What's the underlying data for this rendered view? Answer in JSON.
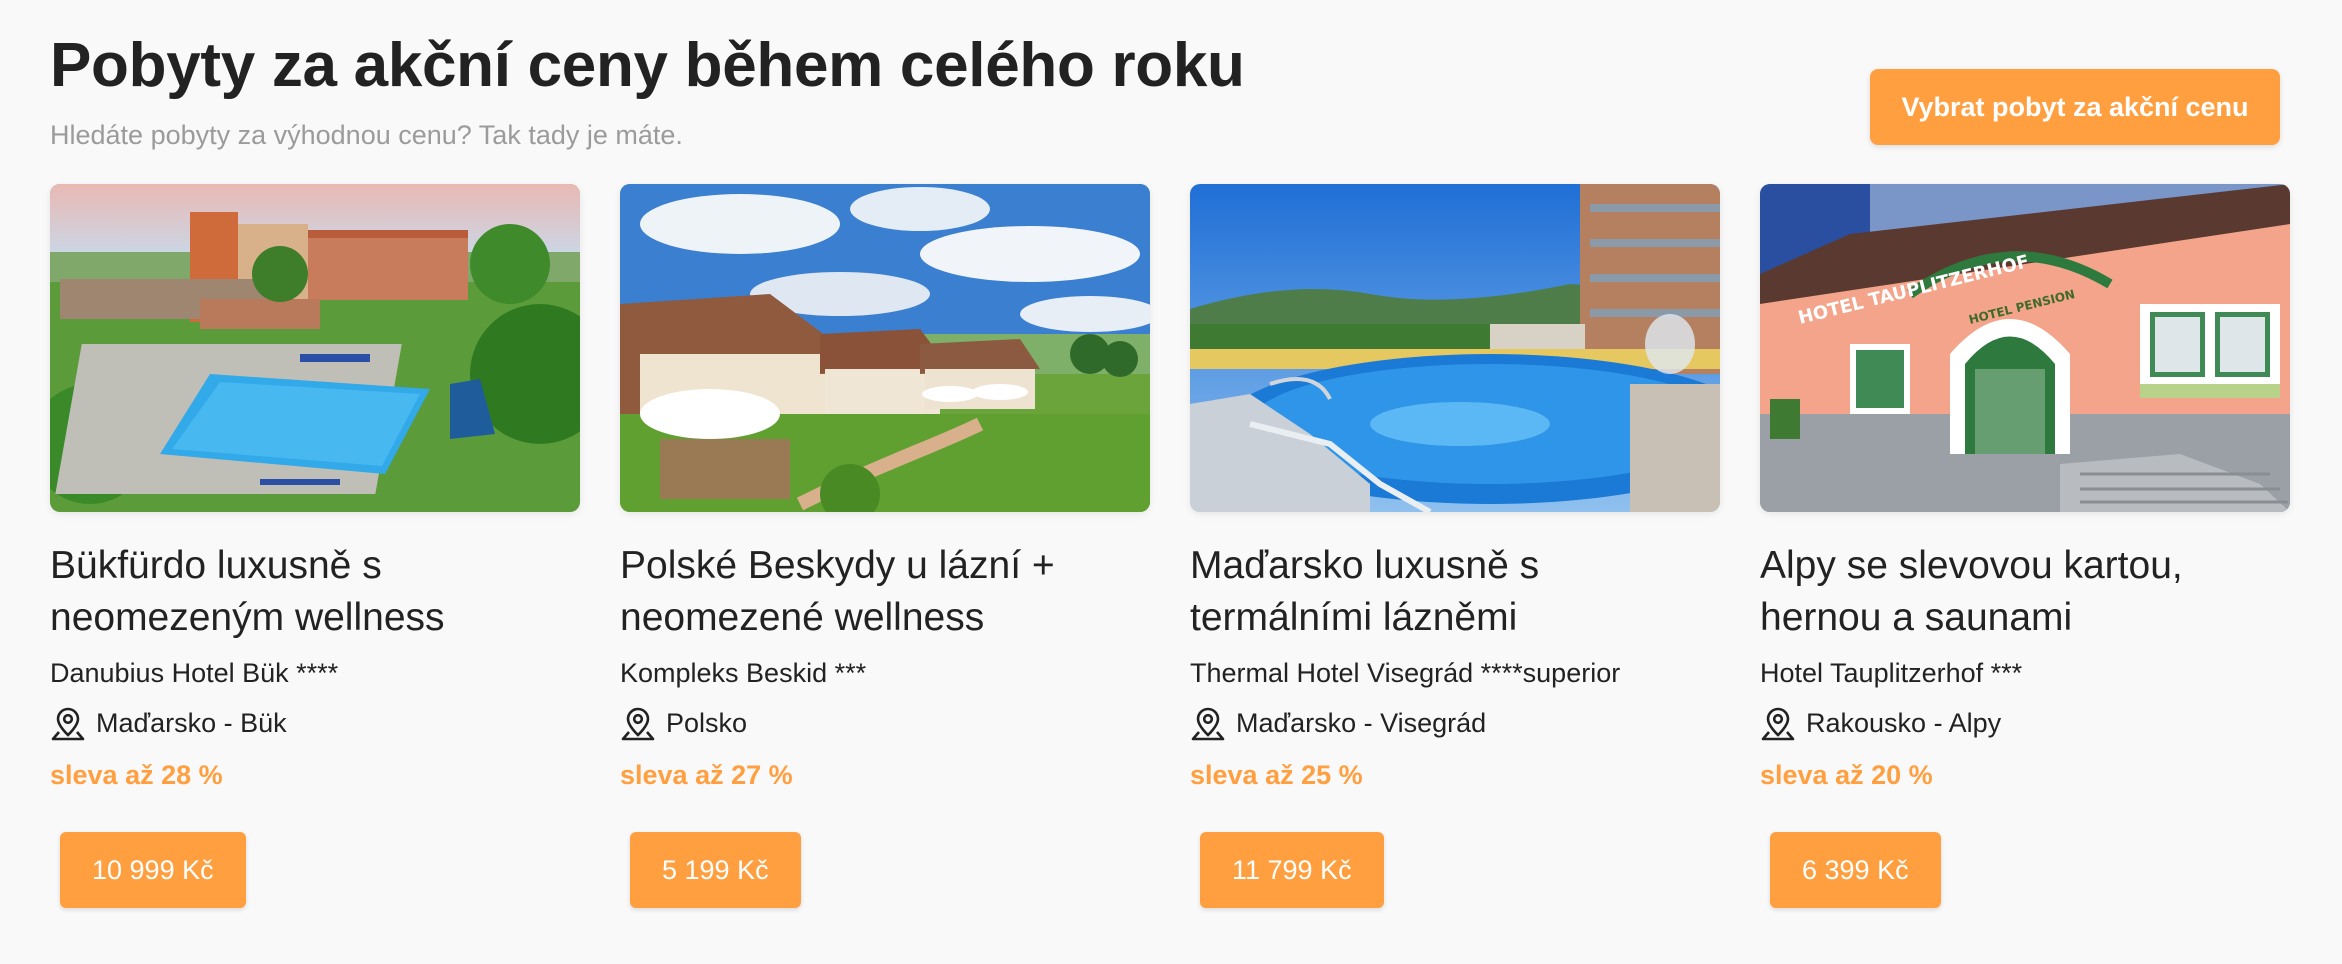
{
  "header": {
    "title": "Pobyty za akční ceny během celého roku",
    "subtitle": "Hledáte pobyty za výhodnou cenu? Tak tady je máte.",
    "cta_label": "Vybrat pobyt za akční cenu"
  },
  "colors": {
    "accent": "#ff9f40",
    "text": "#222222",
    "muted": "#9b9b9b",
    "background": "#f9f9f9"
  },
  "cards": [
    {
      "name_line1": "Bükfürdo luxusně s",
      "name_line2": "neomezeným wellness",
      "hotel": "Danubius Hotel Bük ****",
      "location": "Maďarsko - Bük",
      "discount": "sleva až 28 %",
      "price": "10 999 Kč",
      "image_icon": "hotel-resort-pool-photo"
    },
    {
      "name_line1": "Polské Beskydy u lázní +",
      "name_line2": "neomezené wellness",
      "hotel": "Kompleks Beskid ***",
      "location": "Polsko",
      "discount": "sleva až 27 %",
      "price": "5 199 Kč",
      "image_icon": "mountain-resort-garden-photo"
    },
    {
      "name_line1": "Maďarsko luxusně s",
      "name_line2": "termálními lázněmi",
      "hotel": "Thermal Hotel Visegrád ****superior",
      "location": "Maďarsko - Visegrád",
      "discount": "sleva až 25 %",
      "price": "11 799 Kč",
      "image_icon": "thermal-pool-photo"
    },
    {
      "name_line1": "Alpy se slevovou kartou,",
      "name_line2": "hernou a saunami",
      "hotel": "Hotel Tauplitzerhof ***",
      "location": "Rakousko - Alpy",
      "discount": "sleva až 20 %",
      "price": "6 399 Kč",
      "image_icon": "alpine-hotel-facade-photo",
      "image_text_sign": "HOTEL TAUPLITZERHOF",
      "image_text_arch": "HOTEL PENSION"
    }
  ]
}
